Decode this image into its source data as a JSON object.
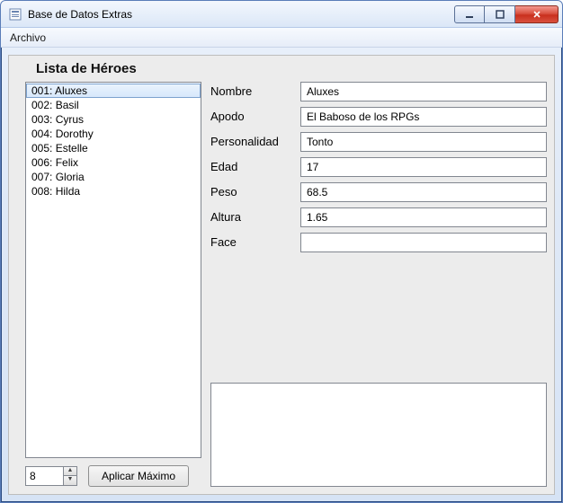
{
  "window": {
    "title": "Base de Datos Extras"
  },
  "menu": {
    "archivo": "Archivo"
  },
  "heading": "Lista de Héroes",
  "heroes": {
    "items": [
      {
        "id": "001",
        "name": "Aluxes",
        "label": "001: Aluxes",
        "selected": true
      },
      {
        "id": "002",
        "name": "Basil",
        "label": "002: Basil",
        "selected": false
      },
      {
        "id": "003",
        "name": "Cyrus",
        "label": "003: Cyrus",
        "selected": false
      },
      {
        "id": "004",
        "name": "Dorothy",
        "label": "004: Dorothy",
        "selected": false
      },
      {
        "id": "005",
        "name": "Estelle",
        "label": "005: Estelle",
        "selected": false
      },
      {
        "id": "006",
        "name": "Felix",
        "label": "006: Felix",
        "selected": false
      },
      {
        "id": "007",
        "name": "Gloria",
        "label": "007: Gloria",
        "selected": false
      },
      {
        "id": "008",
        "name": "Hilda",
        "label": "008: Hilda",
        "selected": false
      }
    ]
  },
  "form": {
    "labels": {
      "nombre": "Nombre",
      "apodo": "Apodo",
      "personalidad": "Personalidad",
      "edad": "Edad",
      "peso": "Peso",
      "altura": "Altura",
      "face": "Face"
    },
    "values": {
      "nombre": "Aluxes",
      "apodo": "El Baboso de los RPGs",
      "personalidad": "Tonto",
      "edad": "17",
      "peso": "68.5",
      "altura": "1.65",
      "face": ""
    },
    "description": ""
  },
  "footer": {
    "max_value": "8",
    "apply_label": "Aplicar Máximo"
  }
}
